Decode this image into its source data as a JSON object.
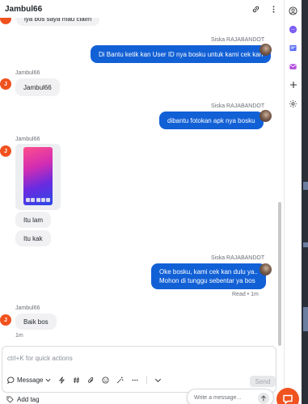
{
  "header": {
    "title": "Jambul66"
  },
  "messages": {
    "m0": {
      "text": "iya bos saya mau claim"
    },
    "m1": {
      "sender": "Siska RAJABANDOT",
      "text": "Di Bantu ketik kan User ID nya bosku untuk kami cek kan"
    },
    "m2": {
      "sender": "Jambul66",
      "avatar_letter": "J",
      "text": "Jambul66"
    },
    "m3": {
      "sender": "Siska RAJABANDOT",
      "text": "dibantu fotokan apk nya bosku"
    },
    "m4": {
      "sender": "Jambul66",
      "avatar_letter": "J",
      "image_alt": "phone-screenshot"
    },
    "m5": {
      "text": "Itu lam"
    },
    "m6": {
      "text": "Itu kak"
    },
    "m7": {
      "sender": "Siska RAJABANDOT",
      "line1": "Oke bosku, kami cek kan dulu ya..",
      "line2": "Mohon di tunggu sebentar ya bos",
      "status": "Read • 1m"
    },
    "m8": {
      "sender": "Jambul66",
      "avatar_letter": "J",
      "text": "Baik bos",
      "time": "1m"
    }
  },
  "composer": {
    "placeholder": "ctrl+K for quick actions",
    "message_label": "Message",
    "send_label": "Send"
  },
  "footer": {
    "add_tag": "Add tag"
  },
  "widget": {
    "placeholder": "Write a message..."
  },
  "colors": {
    "accent": "#1260d6",
    "brand": "#f0521f"
  },
  "icons": [
    "link-icon",
    "more-icon",
    "profile-icon",
    "messenger-icon",
    "channel-icon",
    "mail-icon",
    "plus-icon",
    "settings-icon"
  ]
}
